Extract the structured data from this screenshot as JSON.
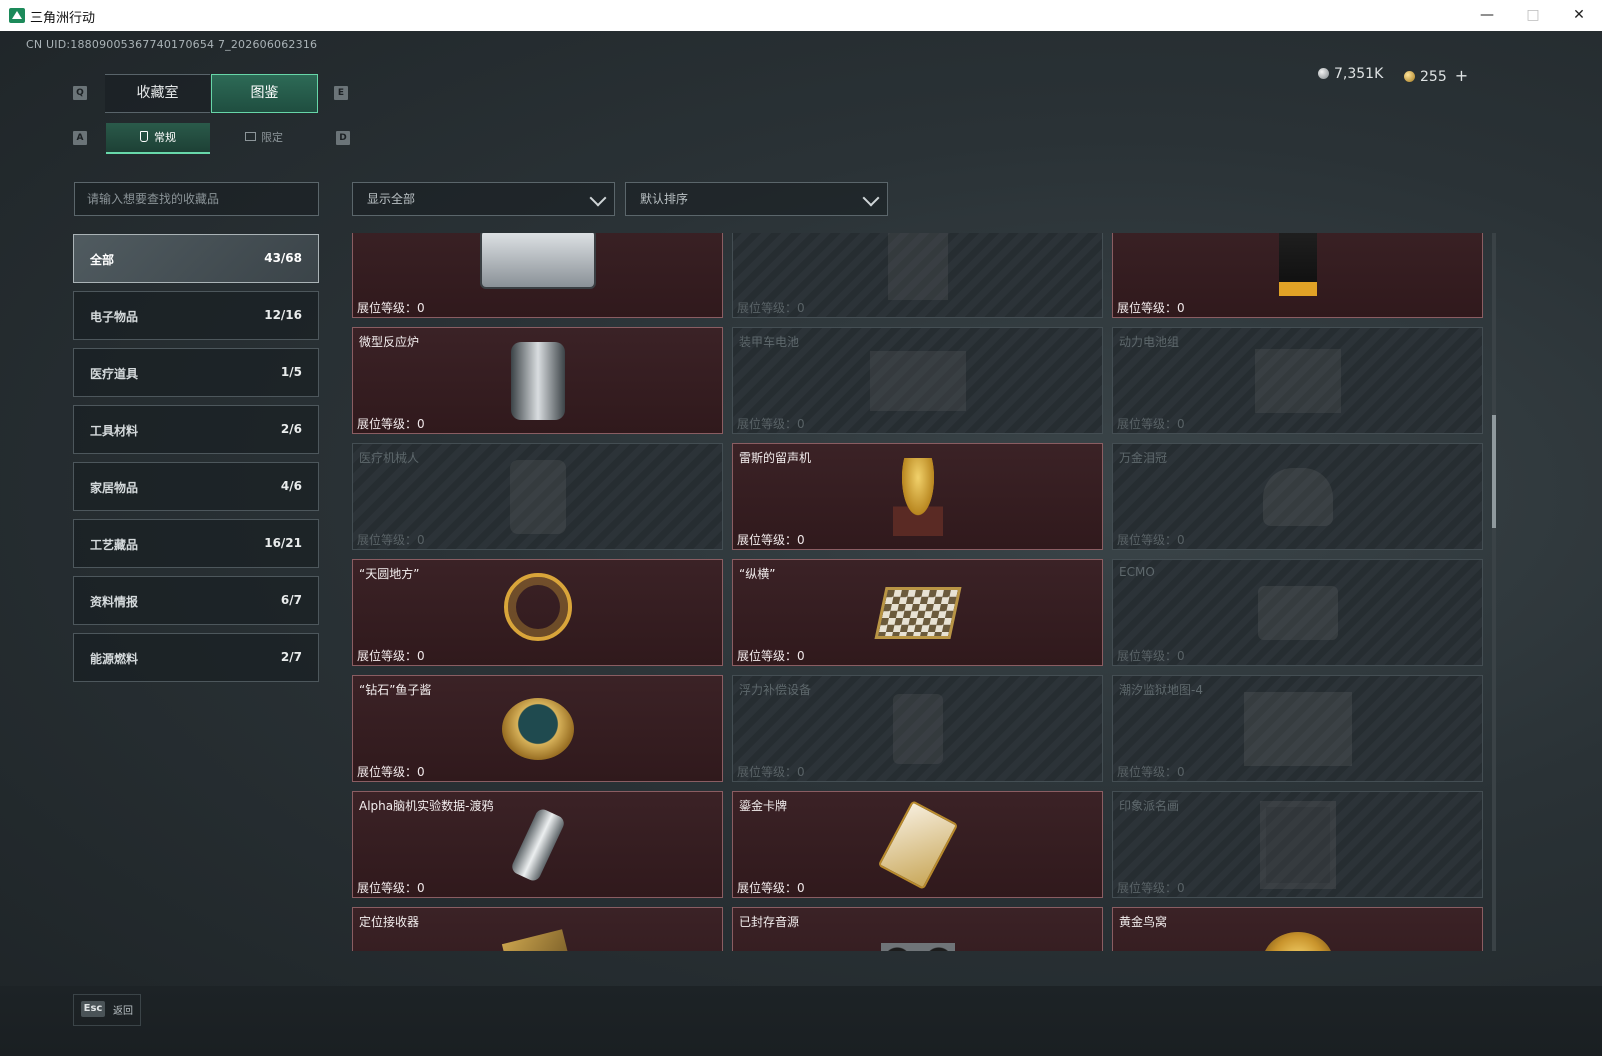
{
  "window": {
    "title": "三角洲行动",
    "min_icon": "minimize-icon",
    "max_icon": "maximize-icon",
    "close_icon": "close-icon"
  },
  "uid": "CN UID:18809005367740170654 7_202606062316",
  "currency": {
    "silver": "7,351K",
    "gold": "255",
    "plus": "+"
  },
  "keys": {
    "prev_tab": "Q",
    "next_tab": "E",
    "prev_sub": "A",
    "next_sub": "D",
    "back": "Esc"
  },
  "tabs": [
    {
      "label": "收藏室",
      "active": false
    },
    {
      "label": "图鉴",
      "active": true
    }
  ],
  "subtabs": [
    {
      "label": "常规",
      "active": true,
      "icon": "tag-icon"
    },
    {
      "label": "限定",
      "active": false,
      "icon": "picture-icon"
    }
  ],
  "search": {
    "placeholder": "请输入想要查找的收藏品"
  },
  "filters": {
    "show": "显示全部",
    "sort": "默认排序"
  },
  "categories": [
    {
      "name": "全部",
      "count": "43/68",
      "active": true
    },
    {
      "name": "电子物品",
      "count": "12/16"
    },
    {
      "name": "医疗道具",
      "count": "1/5"
    },
    {
      "name": "工具材料",
      "count": "2/6"
    },
    {
      "name": "家居物品",
      "count": "4/6"
    },
    {
      "name": "工艺藏品",
      "count": "16/21"
    },
    {
      "name": "资料情报",
      "count": "6/7"
    },
    {
      "name": "能源燃料",
      "count": "2/7"
    }
  ],
  "level_label": "展位等级：",
  "items": [
    {
      "name": "",
      "level": "0",
      "owned": true,
      "art": "server-icon"
    },
    {
      "name": "",
      "level": "0",
      "owned": false,
      "art": "machine-icon"
    },
    {
      "name": "",
      "level": "0",
      "owned": true,
      "art": "coffee-bag-icon"
    },
    {
      "name": "微型反应炉",
      "level": "0",
      "owned": true,
      "art": "reactor-icon"
    },
    {
      "name": "装甲车电池",
      "level": "0",
      "owned": false,
      "art": "battery-icon"
    },
    {
      "name": "动力电池组",
      "level": "0",
      "owned": false,
      "art": "battery-pack-icon"
    },
    {
      "name": "医疗机械人",
      "level": "0",
      "owned": false,
      "art": "robot-icon"
    },
    {
      "name": "雷斯的留声机",
      "level": "0",
      "owned": true,
      "art": "gramophone-icon"
    },
    {
      "name": "万金泪冠",
      "level": "0",
      "owned": false,
      "art": "crown-icon"
    },
    {
      "name": "“天圆地方”",
      "level": "0",
      "owned": true,
      "art": "armillary-icon"
    },
    {
      "name": "“纵横”",
      "level": "0",
      "owned": true,
      "art": "chessboard-icon"
    },
    {
      "name": "ECMO",
      "level": "0",
      "owned": false,
      "art": "ecmo-icon"
    },
    {
      "name": "“钻石”鱼子酱",
      "level": "0",
      "owned": true,
      "art": "caviar-tin-icon"
    },
    {
      "name": "浮力补偿设备",
      "level": "0",
      "owned": false,
      "art": "vest-icon"
    },
    {
      "name": "潮汐监狱地图-4",
      "level": "0",
      "owned": false,
      "art": "map-icon"
    },
    {
      "name": "Alpha脑机实验数据-渡鸦",
      "level": "0",
      "owned": true,
      "art": "data-drive-icon"
    },
    {
      "name": "鎏金卡牌",
      "level": "0",
      "owned": true,
      "art": "card-icon"
    },
    {
      "name": "印象派名画",
      "level": "0",
      "owned": false,
      "art": "painting-icon"
    },
    {
      "name": "定位接收器",
      "level": "",
      "owned": true,
      "art": "receiver-icon"
    },
    {
      "name": "已封存音源",
      "level": "",
      "owned": true,
      "art": "reel-icon"
    },
    {
      "name": "黄金鸟窝",
      "level": "",
      "owned": true,
      "art": "golden-nest-icon"
    }
  ],
  "footer": {
    "back_label": "返回"
  }
}
